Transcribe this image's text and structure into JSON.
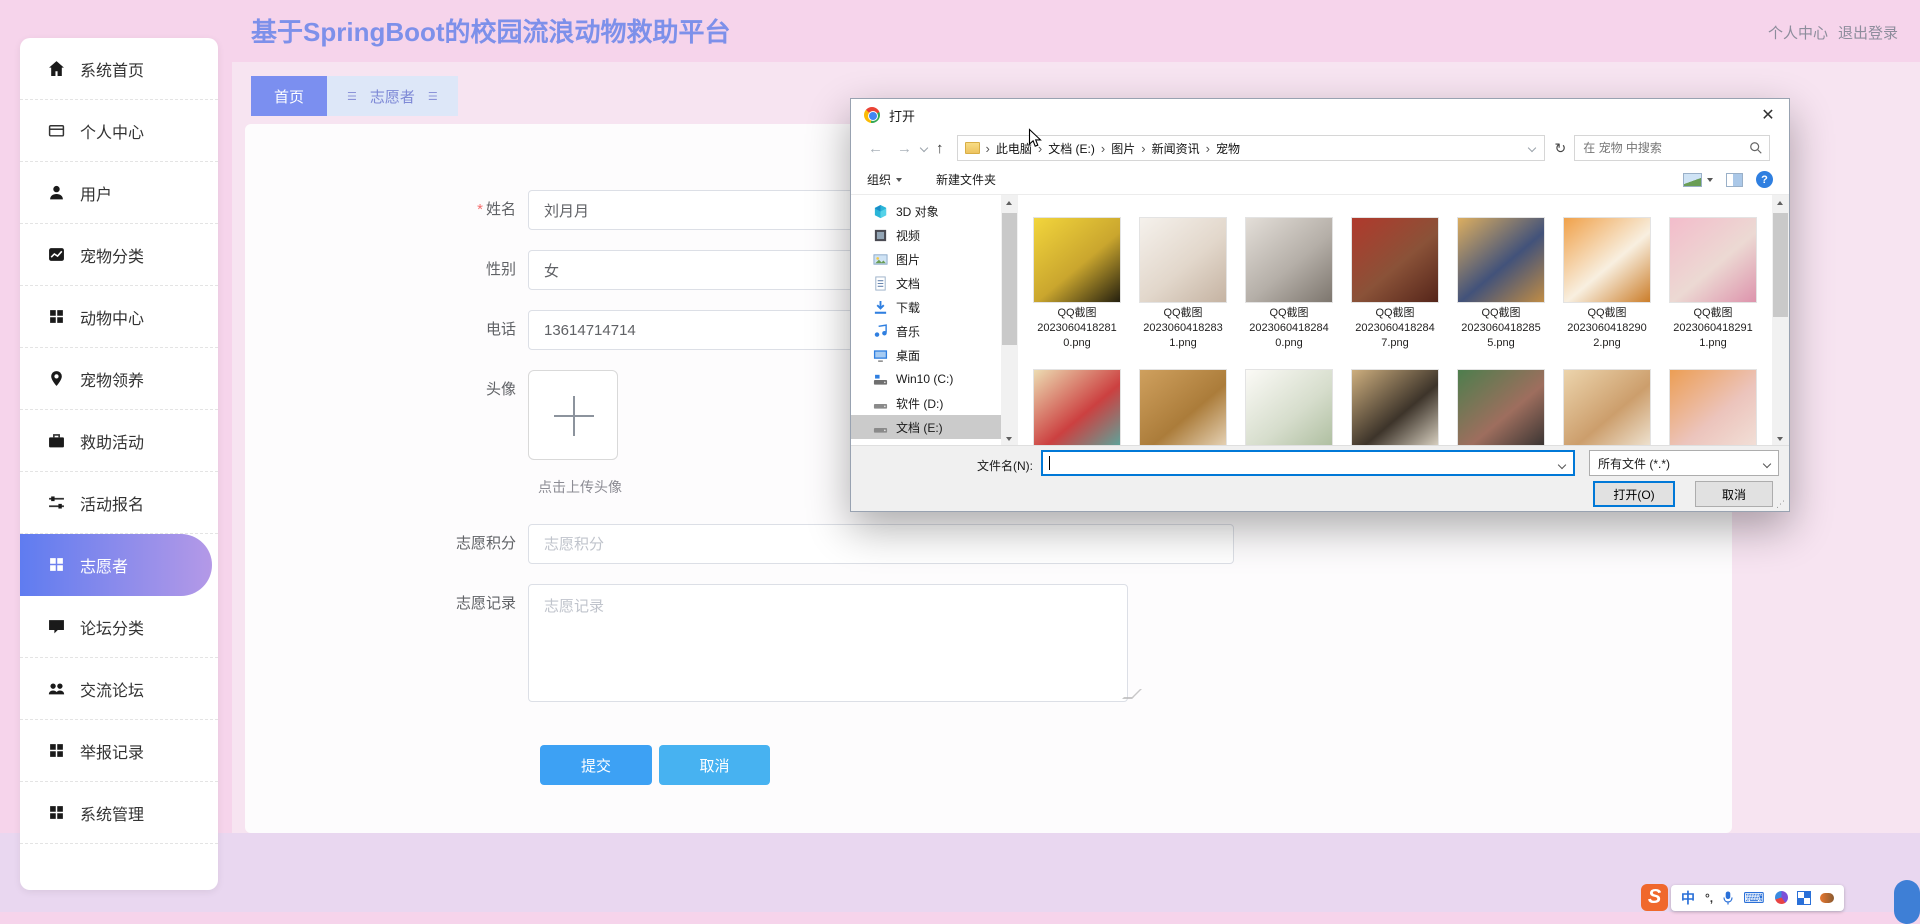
{
  "colors": {
    "accent": "#7b8ff0",
    "header_bg": "#f6d4eb",
    "active_gradient": [
      "#5f7cf0",
      "#b499e7"
    ],
    "submit_button": "#3da1f4",
    "cancel_button": "#47b2f1",
    "dialog_focus_border": "#0078d7"
  },
  "header": {
    "title": "基于SpringBoot的校园流浪动物救助平台",
    "user_center": "个人中心",
    "logout": "退出登录"
  },
  "tabs": {
    "home": "首页",
    "entity": "志愿者"
  },
  "sidebar": {
    "items": [
      {
        "label": "系统首页",
        "icon": "home",
        "active": false
      },
      {
        "label": "个人中心",
        "icon": "card",
        "active": false
      },
      {
        "label": "用户",
        "icon": "user",
        "active": false
      },
      {
        "label": "宠物分类",
        "icon": "chart",
        "active": false
      },
      {
        "label": "动物中心",
        "icon": "grid",
        "active": false
      },
      {
        "label": "宠物领养",
        "icon": "pin",
        "active": false
      },
      {
        "label": "救助活动",
        "icon": "briefcase",
        "active": false
      },
      {
        "label": "活动报名",
        "icon": "sliders",
        "active": false
      },
      {
        "label": "志愿者",
        "icon": "grid",
        "active": true
      },
      {
        "label": "论坛分类",
        "icon": "chat",
        "active": false
      },
      {
        "label": "交流论坛",
        "icon": "forum",
        "active": false
      },
      {
        "label": "举报记录",
        "icon": "grid",
        "active": false
      },
      {
        "label": "系统管理",
        "icon": "grid",
        "active": false
      }
    ]
  },
  "form": {
    "required_mark": "*",
    "name_label": "姓名",
    "name_value": "刘月月",
    "gender_label": "性别",
    "gender_value": "女",
    "phone_label": "电话",
    "phone_value": "13614714714",
    "avatar_label": "头像",
    "avatar_hint": "点击上传头像",
    "points_label": "志愿积分",
    "points_placeholder": "志愿积分",
    "record_label": "志愿记录",
    "record_placeholder": "志愿记录",
    "submit": "提交",
    "cancel": "取消"
  },
  "dialog": {
    "title": "打开",
    "breadcrumb": [
      "此电脑",
      "文档 (E:)",
      "图片",
      "新闻资讯",
      "宠物"
    ],
    "search_placeholder": "在 宠物 中搜索",
    "organize": "组织",
    "new_folder": "新建文件夹",
    "nav_items": [
      {
        "label": "3D 对象",
        "icon": "cube",
        "selected": false
      },
      {
        "label": "视频",
        "icon": "film",
        "selected": false
      },
      {
        "label": "图片",
        "icon": "picture",
        "selected": false
      },
      {
        "label": "文档",
        "icon": "doc",
        "selected": false
      },
      {
        "label": "下载",
        "icon": "download",
        "selected": false
      },
      {
        "label": "音乐",
        "icon": "music",
        "selected": false
      },
      {
        "label": "桌面",
        "icon": "desktop",
        "selected": false
      },
      {
        "label": "Win10 (C:)",
        "icon": "driveos",
        "selected": false
      },
      {
        "label": "软件 (D:)",
        "icon": "drive",
        "selected": false
      },
      {
        "label": "文档 (E:)",
        "icon": "drive",
        "selected": true
      }
    ],
    "files": [
      {
        "lines": [
          "QQ截图",
          "2023060418281",
          "0.png"
        ],
        "colors": [
          "#f2d53c",
          "#caa62e",
          "#25200f"
        ]
      },
      {
        "lines": [
          "QQ截图",
          "2023060418283",
          "1.png"
        ],
        "colors": [
          "#f5f1ec",
          "#e2d7cb",
          "#c5b3a2"
        ]
      },
      {
        "lines": [
          "QQ截图",
          "2023060418284",
          "0.png"
        ],
        "colors": [
          "#e3ded8",
          "#b5afa8",
          "#7d766e"
        ]
      },
      {
        "lines": [
          "QQ截图",
          "2023060418284",
          "7.png"
        ],
        "colors": [
          "#b0392c",
          "#8a5238",
          "#55251a"
        ]
      },
      {
        "lines": [
          "QQ截图",
          "2023060418285",
          "5.png"
        ],
        "colors": [
          "#dcae60",
          "#42527a",
          "#c08c45"
        ]
      },
      {
        "lines": [
          "QQ截图",
          "2023060418290",
          "2.png"
        ],
        "colors": [
          "#f0a14a",
          "#f8efe0",
          "#cb7d2a"
        ]
      },
      {
        "lines": [
          "QQ截图",
          "2023060418291",
          "1.png"
        ],
        "colors": [
          "#f3bccb",
          "#ecd9d3",
          "#dd93ac"
        ]
      },
      {
        "lines": [],
        "colors": [
          "#ecdcb2",
          "#cc4040",
          "#4fb0a6"
        ]
      },
      {
        "lines": [],
        "colors": [
          "#cfa05e",
          "#ab7c3a",
          "#ecdcc4"
        ]
      },
      {
        "lines": [],
        "colors": [
          "#fbfaf6",
          "#d6ddcc",
          "#aabb9b"
        ]
      },
      {
        "lines": [],
        "colors": [
          "#cdae7e",
          "#3d342a",
          "#ece4d4"
        ]
      },
      {
        "lines": [],
        "colors": [
          "#4d7e4d",
          "#9e6e5e",
          "#2d2d2d"
        ]
      },
      {
        "lines": [],
        "colors": [
          "#ecd4ac",
          "#cc9e6c",
          "#f2eadc"
        ]
      },
      {
        "lines": [],
        "colors": [
          "#ec9e54",
          "#ecc4bc",
          "#f2e2da"
        ]
      }
    ],
    "filename_label": "文件名(N):",
    "filename_value": "",
    "filetype": "所有文件 (*.*)",
    "open_button": "打开(O)",
    "cancel_button": "取消"
  },
  "ime": {
    "logo": "S",
    "lang": "中",
    "punct": "°,"
  }
}
